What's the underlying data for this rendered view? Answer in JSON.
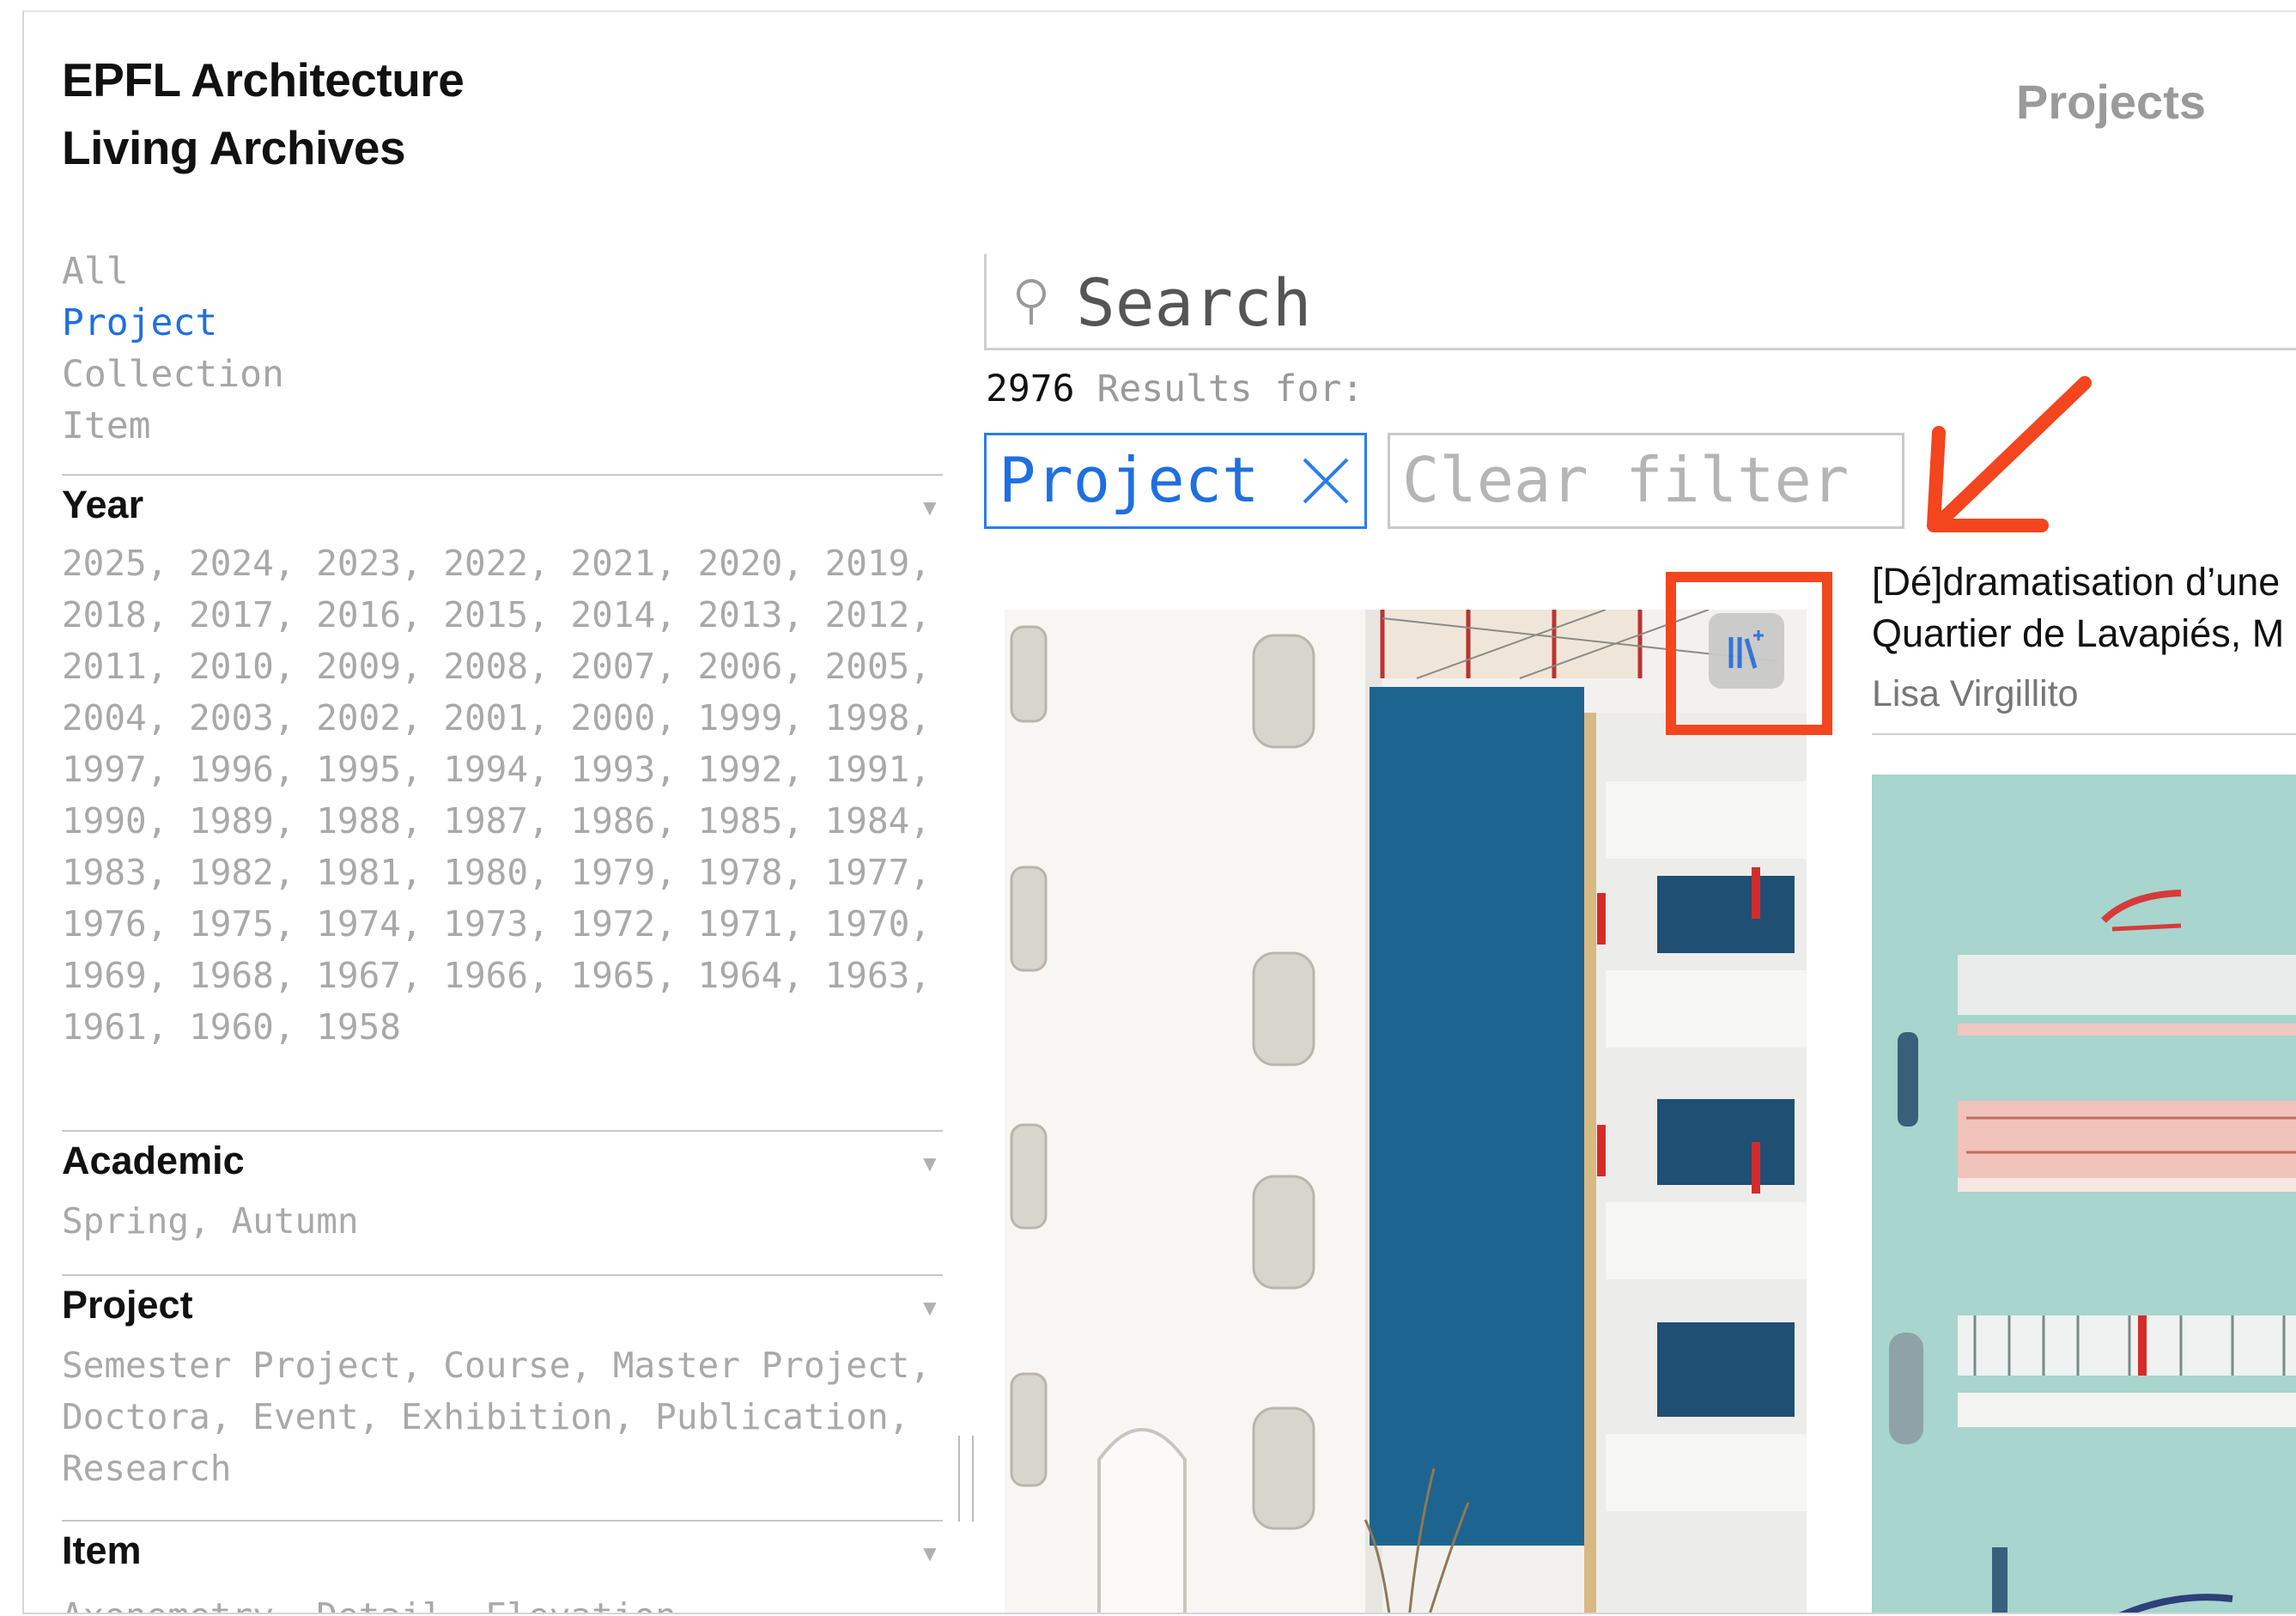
{
  "header": {
    "brand_line1": "EPFL Architecture",
    "brand_line2": "Living Archives",
    "nav_projects": "Projects"
  },
  "type_filter": [
    "All",
    "Project",
    "Collection",
    "Item"
  ],
  "type_filter_active": "Project",
  "facets": {
    "year": {
      "title": "Year",
      "values": "2025, 2024, 2023, 2022, 2021, 2020, 2019, 2018, 2017, 2016, 2015, 2014, 2013, 2012, 2011, 2010, 2009, 2008, 2007, 2006, 2005, 2004, 2003, 2002, 2001, 2000, 1999, 1998, 1997, 1996, 1995, 1994, 1993, 1992, 1991, 1990, 1989, 1988, 1987, 1986, 1985, 1984, 1983, 1982, 1981, 1980, 1979, 1978, 1977, 1976, 1975, 1974, 1973, 1972, 1971, 1970, 1969, 1968, 1967, 1966, 1965, 1964, 1963, 1961, 1960, 1958"
    },
    "academic": {
      "title": "Academic",
      "values": "Spring, Autumn"
    },
    "project": {
      "title": "Project",
      "values": "Semester Project, Course, Master Project, Doctora, Event, Exhibition, Publication, Research"
    },
    "item": {
      "title": "Item",
      "values": "Axonometry, Detail, Elevation"
    }
  },
  "search": {
    "placeholder": "Search",
    "value": ""
  },
  "results": {
    "count": "2976",
    "label": "Results for:"
  },
  "active_filters": {
    "chip_label": "Project",
    "clear_label": "Clear filter"
  },
  "card2": {
    "title_line1": "[Dé]dramatisation d’une",
    "title_line2": "Quartier de Lavapiés, M",
    "author": "Lisa Virgillito"
  },
  "colors": {
    "accent": "#1f6fe0",
    "annotation": "#f3451e",
    "muted": "#a9a9a9"
  },
  "icons": {
    "collect": "collect-plus-icon",
    "remove_filter": "close-icon",
    "search": "search-icon",
    "facet_toggle": "triangle-down-icon"
  }
}
